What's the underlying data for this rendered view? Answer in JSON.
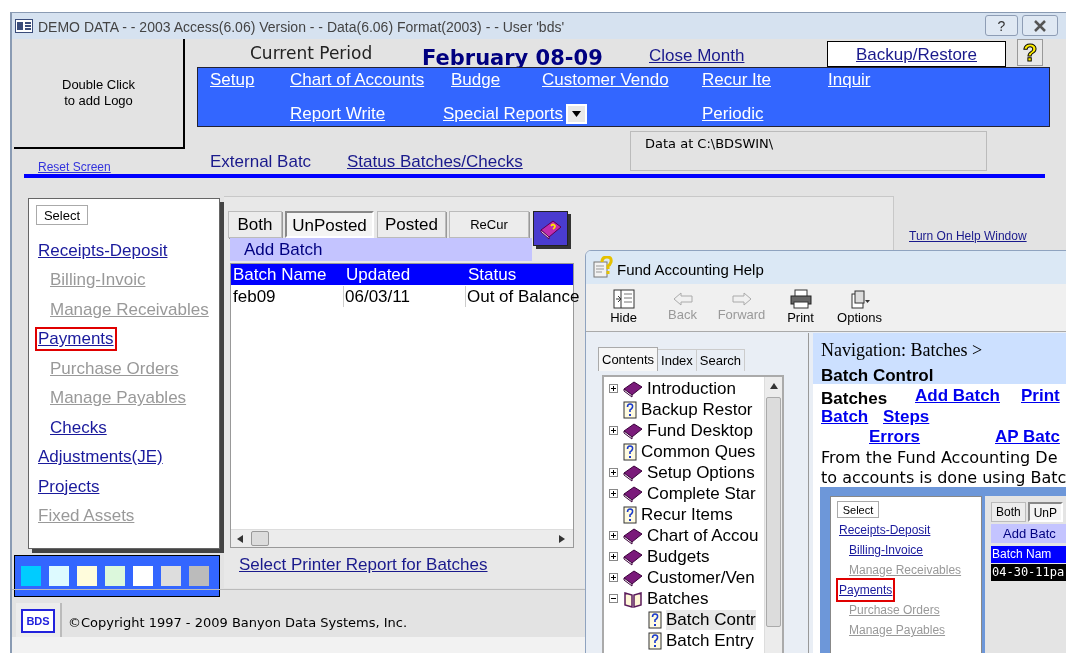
{
  "main_window": {
    "title": "DEMO DATA - - 2003 Access(6.06) Version - - Data(6.06) Format(2003) - -  User 'bds'",
    "title_buttons": [
      {
        "kind": "help",
        "label": "?"
      },
      {
        "kind": "close"
      }
    ],
    "logo_box": {
      "lines": [
        "Double Click",
        "to add Logo"
      ]
    },
    "header": {
      "period_label": "Current Period",
      "period": "February 08-09",
      "close_month": "Close Month",
      "backup": "Backup/Restore",
      "help_button": "?"
    },
    "nav_menu": {
      "rows": [
        [
          {
            "label": "Setup",
            "dropdown": false
          },
          {
            "label": "Chart of Accounts",
            "dropdown": false
          },
          {
            "label": "Budge",
            "dropdown": false
          },
          {
            "label": "Customer Vendo",
            "dropdown": false
          },
          {
            "label": "Recur Ite",
            "dropdown": false
          },
          {
            "label": "Inquir",
            "dropdown": false
          }
        ],
        [
          null,
          {
            "label": "Report Write",
            "dropdown": false
          },
          {
            "label": "Special Reports",
            "dropdown": true
          },
          null,
          {
            "label": "Periodic",
            "dropdown": false
          }
        ]
      ]
    },
    "reset_screen": "Reset Screen",
    "external_batch": "External Batc",
    "status_batches": "Status Batches/Checks",
    "data_path": "Data at C:\\BDSWIN\\",
    "menu": {
      "select_button": "Select",
      "items": [
        {
          "label": "Receipts-Deposit",
          "kind": "main",
          "disabled": false,
          "selected": false
        },
        {
          "label": "Billing-Invoic",
          "kind": "sub",
          "disabled": true,
          "selected": false
        },
        {
          "label": "Manage Receivables",
          "kind": "sub",
          "disabled": true,
          "selected": false
        },
        {
          "label": "Payments",
          "kind": "main",
          "disabled": false,
          "selected": true
        },
        {
          "label": "Purchase Orders",
          "kind": "sub",
          "disabled": true,
          "selected": false
        },
        {
          "label": "Manage Payables",
          "kind": "sub",
          "disabled": true,
          "selected": false
        },
        {
          "label": "Checks",
          "kind": "sub",
          "disabled": false,
          "selected": false
        },
        {
          "label": "Adjustments(JE)",
          "kind": "main",
          "disabled": false,
          "selected": false
        },
        {
          "label": "Projects",
          "kind": "main",
          "disabled": false,
          "selected": false
        },
        {
          "label": "Fixed Assets",
          "kind": "main",
          "disabled": true,
          "selected": false
        }
      ]
    },
    "color_swatches": [
      {
        "color": "#00ccff"
      },
      {
        "color": "#ddfaff"
      },
      {
        "color": "#fffcdc"
      },
      {
        "color": "#dcf8dc"
      },
      {
        "color": "#ffffff"
      },
      {
        "color": "#dddddd"
      },
      {
        "color": "#bbbbbb"
      }
    ],
    "tabs": [
      {
        "label": "Both",
        "selected": false
      },
      {
        "label": "UnPosted",
        "selected": true
      },
      {
        "label": "Posted",
        "selected": false
      },
      {
        "label": "ReCur",
        "selected": false
      }
    ],
    "add_batch": "Add Batch",
    "table": {
      "columns": [
        "Batch Name",
        "Updated",
        "Status"
      ],
      "rows": [
        [
          "feb09",
          "06/03/11",
          "Out of Balance"
        ]
      ]
    },
    "select_printer": "Select Printer Report for Batches",
    "help_window_link": "Turn On Help Window",
    "footer": {
      "logo": "BDS",
      "copyright": "©Copyright 1997 - 2009  Banyon Data Systems, Inc."
    }
  },
  "help_window": {
    "title": "Fund Accounting Help",
    "toolbar": [
      {
        "label": "Hide",
        "kind": "hide",
        "disabled": false
      },
      {
        "label": "Back",
        "kind": "back",
        "disabled": true
      },
      {
        "label": "Forward",
        "kind": "forward",
        "disabled": true
      },
      {
        "label": "Print",
        "kind": "print",
        "disabled": false
      },
      {
        "label": "Options",
        "kind": "options",
        "disabled": false
      }
    ],
    "tabs": [
      {
        "label": "Contents",
        "selected": true
      },
      {
        "label": "Index",
        "selected": false
      },
      {
        "label": "Search",
        "selected": false
      }
    ],
    "tree": [
      {
        "label": "Introduction",
        "kind": "book",
        "expanded": false
      },
      {
        "label": "Backup Restor",
        "kind": "page"
      },
      {
        "label": "Fund Desktop",
        "kind": "book",
        "expanded": false
      },
      {
        "label": "Common Ques",
        "kind": "page"
      },
      {
        "label": "Setup Options",
        "kind": "book",
        "expanded": false
      },
      {
        "label": "Complete Star",
        "kind": "book",
        "expanded": false
      },
      {
        "label": "Recur Items",
        "kind": "page"
      },
      {
        "label": "Chart of Accou",
        "kind": "book",
        "expanded": false
      },
      {
        "label": "Budgets",
        "kind": "book",
        "expanded": false
      },
      {
        "label": "Customer/Ven",
        "kind": "book",
        "expanded": false
      },
      {
        "label": "Batches",
        "kind": "book",
        "expanded": true,
        "children": [
          {
            "label": "Batch Contr",
            "kind": "page",
            "selected": true
          },
          {
            "label": "Batch Entry",
            "kind": "page",
            "selected": false
          }
        ]
      }
    ],
    "content": {
      "breadcrumb": "Navigation: Batches >",
      "heading": "Batch Control",
      "label": "Batches",
      "links": [
        [
          "Add Batch",
          "Print"
        ],
        [
          "Batch",
          "Steps"
        ],
        [
          "Errors",
          "AP Batc"
        ]
      ],
      "paragraph": [
        "From the Fund Accounting De",
        "to accounts is done using Batc"
      ],
      "screenshot": {
        "select_button": "Select",
        "items": [
          {
            "label": "Receipts-Deposit",
            "kind": "main",
            "disabled": false,
            "selected": false
          },
          {
            "label": "Billing-Invoice",
            "kind": "sub",
            "disabled": false,
            "selected": false
          },
          {
            "label": "Manage Receivables",
            "kind": "sub",
            "disabled": true,
            "selected": false
          },
          {
            "label": "Payments",
            "kind": "main",
            "disabled": false,
            "selected": true
          },
          {
            "label": "Purchase Orders",
            "kind": "sub",
            "disabled": true,
            "selected": false
          },
          {
            "label": "Manage Payables",
            "kind": "sub",
            "disabled": true,
            "selected": false
          }
        ],
        "tabs": [
          {
            "label": "Both",
            "selected": false
          },
          {
            "label": "UnP",
            "selected": true
          }
        ],
        "add_batch": "Add Batc",
        "column": "Batch Nam",
        "row": "04-30-11pa"
      }
    }
  }
}
